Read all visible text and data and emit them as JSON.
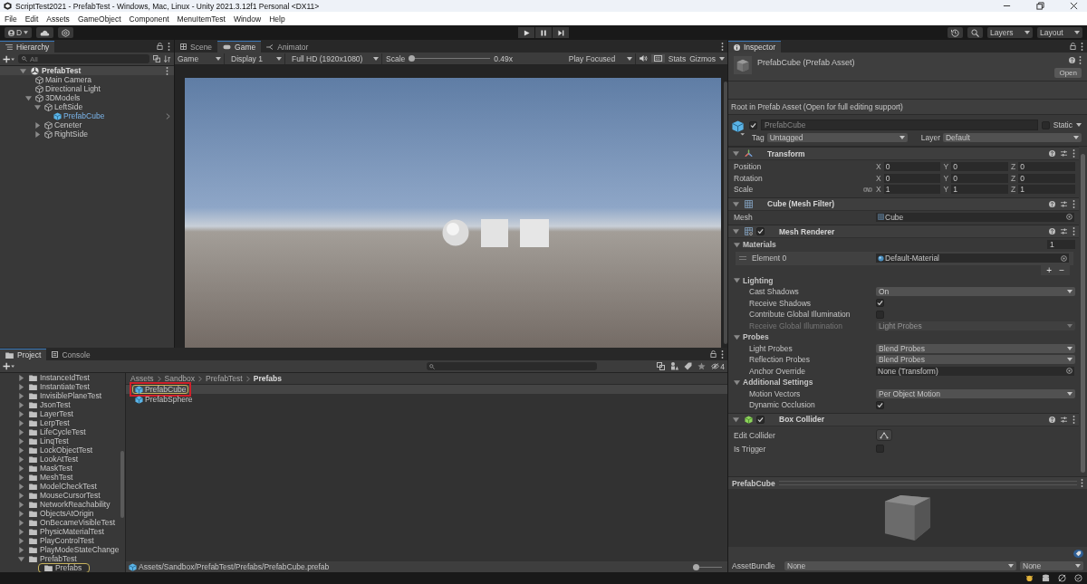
{
  "window": {
    "title": "ScriptTest2021 - PrefabTest - Windows, Mac, Linux - Unity 2021.3.12f1 Personal <DX11>"
  },
  "menu": [
    "File",
    "Edit",
    "Assets",
    "GameObject",
    "Component",
    "MenuItemTest",
    "Window",
    "Help"
  ],
  "toolbar": {
    "account": "D",
    "layers": "Layers",
    "layout": "Layout"
  },
  "hierarchy": {
    "tab": "Hierarchy",
    "search_placeholder": "All",
    "scene": "PrefabTest",
    "items": [
      {
        "name": "Main Camera",
        "kind": "object"
      },
      {
        "name": "Directional Light",
        "kind": "object"
      },
      {
        "name": "3DModels",
        "kind": "object",
        "expanded": true,
        "children": [
          {
            "name": "LeftSide",
            "kind": "object",
            "expanded": true,
            "children": [
              {
                "name": "PrefabCube",
                "kind": "prefab"
              }
            ]
          },
          {
            "name": "Ceneter",
            "kind": "object",
            "expanded": false
          },
          {
            "name": "RightSide",
            "kind": "object",
            "expanded": false
          }
        ]
      }
    ]
  },
  "game": {
    "tabs": [
      {
        "label": "Scene",
        "selected": false
      },
      {
        "label": "Game",
        "selected": true
      },
      {
        "label": "Animator",
        "selected": false
      }
    ],
    "mode": "Game",
    "display": "Display 1",
    "resolution": "Full HD (1920x1080)",
    "scale_label": "Scale",
    "scale": {
      "level": 0.0
    },
    "scale_value": "0.49x",
    "play_focused": "Play Focused",
    "shortcuts_toggle": {
      "on": true
    },
    "stats": "Stats",
    "gizmos": "Gizmos"
  },
  "project": {
    "tabs": [
      {
        "label": "Project",
        "selected": true
      },
      {
        "label": "Console",
        "selected": false
      }
    ],
    "folders": [
      {
        "name": "InstanceIdTest",
        "expanded": false,
        "selected": false
      },
      {
        "name": "InstantiateTest",
        "expanded": false,
        "selected": false
      },
      {
        "name": "InvisiblePlaneTest",
        "expanded": false,
        "selected": false
      },
      {
        "name": "JsonTest",
        "expanded": false,
        "selected": false
      },
      {
        "name": "LayerTest",
        "expanded": false,
        "selected": false
      },
      {
        "name": "LerpTest",
        "expanded": false,
        "selected": false
      },
      {
        "name": "LifeCycleTest",
        "expanded": false,
        "selected": false
      },
      {
        "name": "LinqTest",
        "expanded": false,
        "selected": false
      },
      {
        "name": "LockObjectTest",
        "expanded": false,
        "selected": false
      },
      {
        "name": "LookAtTest",
        "expanded": false,
        "selected": false
      },
      {
        "name": "MaskTest",
        "expanded": false,
        "selected": false
      },
      {
        "name": "MeshTest",
        "expanded": false,
        "selected": false
      },
      {
        "name": "ModelCheckTest",
        "expanded": false,
        "selected": false
      },
      {
        "name": "MouseCursorTest",
        "expanded": false,
        "selected": false
      },
      {
        "name": "NetworkReachability",
        "expanded": false,
        "selected": false
      },
      {
        "name": "ObjectsAtOrigin",
        "expanded": false,
        "selected": false
      },
      {
        "name": "OnBecameVisibleTest",
        "expanded": false,
        "selected": false
      },
      {
        "name": "PhysicMaterialTest",
        "expanded": false,
        "selected": false
      },
      {
        "name": "PlayControlTest",
        "expanded": false,
        "selected": false
      },
      {
        "name": "PlayModeStateChange",
        "expanded": false,
        "selected": false
      },
      {
        "name": "PrefabTest",
        "expanded": true,
        "selected": false,
        "children": [
          {
            "name": "Prefabs",
            "selected": true
          }
        ]
      }
    ],
    "breadcrumb": [
      "Assets",
      "Sandbox",
      "PrefabTest",
      "Prefabs"
    ],
    "assets": [
      {
        "name": "PrefabCube",
        "selected": true,
        "highlighted": true
      },
      {
        "name": "PrefabSphere",
        "selected": false,
        "highlighted": false
      }
    ],
    "hidden_count": "4",
    "path": "Assets/Sandbox/PrefabTest/Prefabs/PrefabCube.prefab",
    "zoom": {
      "level": 0.0
    }
  },
  "inspector": {
    "tab": "Inspector",
    "asset_title": "PrefabCube (Prefab Asset)",
    "open": "Open",
    "note": "Root in Prefab Asset (Open for full editing support)",
    "object": {
      "active": true,
      "name": "PrefabCube",
      "static": false,
      "static_label": "Static",
      "tag_label": "Tag",
      "tag": "Untagged",
      "layer_label": "Layer",
      "layer": "Default"
    },
    "components": [
      {
        "kind": "transform",
        "title": "Transform",
        "expanded": true,
        "rows": [
          {
            "kind": "vector3",
            "label": "Position",
            "values": [
              {
                "axis": "X",
                "value": "0"
              },
              {
                "axis": "Y",
                "value": "0"
              },
              {
                "axis": "Z",
                "value": "0"
              }
            ]
          },
          {
            "kind": "vector3",
            "label": "Rotation",
            "values": [
              {
                "axis": "X",
                "value": "0"
              },
              {
                "axis": "Y",
                "value": "0"
              },
              {
                "axis": "Z",
                "value": "0"
              }
            ]
          },
          {
            "kind": "vector3",
            "label": "Scale",
            "constrained": false,
            "values": [
              {
                "axis": "X",
                "value": "1"
              },
              {
                "axis": "Y",
                "value": "1"
              },
              {
                "axis": "Z",
                "value": "1"
              }
            ]
          }
        ]
      },
      {
        "kind": "mesh_filter",
        "title": "Cube (Mesh Filter)",
        "expanded": true,
        "rows": [
          {
            "kind": "object",
            "label": "Mesh",
            "value": "Cube",
            "ref": {
              "kind": "mesh"
            }
          }
        ]
      },
      {
        "kind": "mesh_renderer",
        "title": "Mesh Renderer",
        "enabled": true,
        "expanded": true,
        "rows": [
          {
            "kind": "list",
            "label": "Materials",
            "expanded": true,
            "count": "1",
            "elements": [
              {
                "label": "Element 0",
                "value": "Default-Material",
                "ref": {
                  "kind": "material"
                }
              }
            ],
            "buttons": [
              "+",
              "−"
            ]
          },
          {
            "kind": "foldout",
            "label": "Lighting",
            "expanded": true,
            "children": [
              {
                "kind": "dropdown",
                "label": "Cast Shadows",
                "value": "On",
                "disabled": false
              },
              {
                "kind": "checkbox",
                "label": "Receive Shadows",
                "checked": true
              },
              {
                "kind": "checkbox",
                "label": "Contribute Global Illumination",
                "checked": false
              },
              {
                "kind": "dropdown",
                "label": "Receive Global Illumination",
                "value": "Light Probes",
                "disabled": true
              }
            ]
          },
          {
            "kind": "foldout",
            "label": "Probes",
            "expanded": true,
            "children": [
              {
                "kind": "dropdown",
                "label": "Light Probes",
                "value": "Blend Probes",
                "disabled": false
              },
              {
                "kind": "dropdown",
                "label": "Reflection Probes",
                "value": "Blend Probes",
                "disabled": false
              },
              {
                "kind": "object",
                "label": "Anchor Override",
                "value": "None (Transform)"
              }
            ]
          },
          {
            "kind": "foldout",
            "label": "Additional Settings",
            "expanded": true,
            "children": [
              {
                "kind": "dropdown",
                "label": "Motion Vectors",
                "value": "Per Object Motion",
                "disabled": false
              },
              {
                "kind": "checkbox",
                "label": "Dynamic Occlusion",
                "checked": true
              }
            ]
          }
        ]
      },
      {
        "kind": "box_collider",
        "title": "Box Collider",
        "enabled": true,
        "expanded": true,
        "rows": [
          {
            "kind": "icon_button",
            "label": "Edit Collider"
          },
          {
            "kind": "checkbox",
            "label": "Is Trigger",
            "checked": false
          }
        ]
      }
    ],
    "preview": {
      "title": "PrefabCube"
    },
    "asset_bundle": {
      "label": "AssetBundle",
      "name": "None",
      "variant": "None"
    }
  }
}
